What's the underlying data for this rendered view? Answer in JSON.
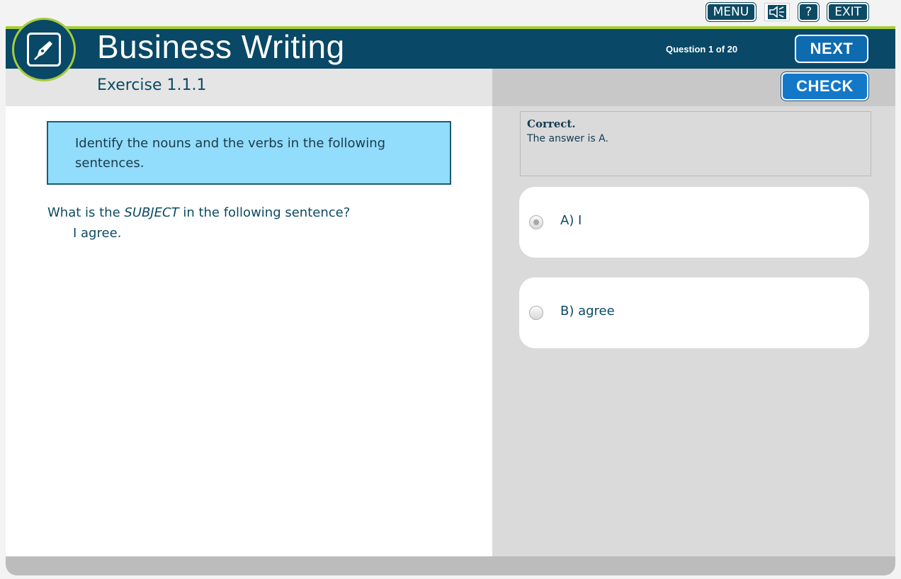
{
  "toolbar": {
    "menu_label": "MENU",
    "sound_icon": "speaker-mute-icon",
    "help_label": "?",
    "exit_label": "EXIT"
  },
  "header": {
    "logo_icon": "pen-nib-icon",
    "title": "Business Writing",
    "question_counter": "Question 1 of 20",
    "next_label": "NEXT",
    "check_label": "CHECK"
  },
  "exercise": {
    "title": "Exercise 1.1.1",
    "instructions": "Identify the nouns and the verbs in the following sentences.",
    "question_prefix": "What is the ",
    "question_emphasis": "SUBJECT",
    "question_suffix": " in the following sentence?",
    "sentence": "I agree."
  },
  "feedback": {
    "title": "Correct.",
    "text": "The answer is A."
  },
  "options": [
    {
      "label": "A) I",
      "selected": true
    },
    {
      "label": "B) agree",
      "selected": false
    }
  ],
  "colors": {
    "header_bg": "#094866",
    "accent_green": "#a6cd3a",
    "button_blue": "#1478c8",
    "instruction_bg": "#92dcfc"
  }
}
